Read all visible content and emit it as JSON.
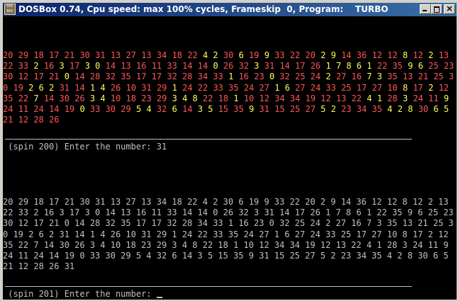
{
  "window": {
    "title": "DOSBox 0.74, Cpu speed: max 100% cycles, Frameskip  0, Program:    TURBO",
    "icon_label": "DOS BOX",
    "buttons": [
      "minimize-icon",
      "maximize-icon",
      "close-icon"
    ]
  },
  "colors": {
    "background": "#000000",
    "text": "#c0c0c0",
    "bright_high": "#ffff55",
    "bright_low": "#ff5555"
  },
  "spin200": {
    "sequence": "20 29 18 17 21 30 31 13 27 13 34 18 22 4 2 30 6 19 9 33 22 20 2 9 14 36 12 12 8 12 2 13 22 33 2 16 3 17 3 0 14 13 16 11 33 14 14 0 26 32 3 31 14 17 26 1 7 8 6 1 22 35 9 6 25 23 30 12 17 21 0 14 28 32 35 17 17 32 28 34 33 1 16 23 0 32 25 24 2 27 16 7 3 35 13 21 25 30 19 2 6 2 31 14 1 4 26 10 31 29 1 24 22 33 35 24 27 1 6 27 24 33 25 17 27 10 8 17 2 12 35 22 7 14 30 26 3 4 10 18 23 29 3 4 8 22 18 1 10 12 34 34 19 12 13 22 4 1 28 3 24 11 9 24 11 24 14 19 0 33 30 29 5 4 32 6 14 3 5 15 35 9 31 15 25 27 5 2 23 34 35 4 2 8 30 6 5 21 12 28 26",
    "prompt": " (spin 200) Enter the number: 31"
  },
  "spin201": {
    "sequence": "20 29 18 17 21 30 31 13 27 13 34 18 22 4 2 30 6 19 9 33 22 20 2 9 14 36 12 12 8 12 2 13 22 33 2 16 3 17 3 0 14 13 16 11 33 14 14 0 26 32 3 31 14 17 26 1 7 8 6 1 22 35 9 6 25 23 30 12 17 21 0 14 28 32 35 17 17 32 28 34 33 1 16 23 0 32 25 24 2 27 16 7 3 35 13 21 25 30 19 2 6 2 31 14 1 4 26 10 31 29 1 24 22 33 35 24 27 1 6 27 24 33 25 17 27 10 8 17 2 12 35 22 7 14 30 26 3 4 10 18 23 29 3 4 8 22 18 1 10 12 34 34 19 12 13 22 4 1 28 3 24 11 9 24 11 24 14 19 0 33 30 29 5 4 32 6 14 3 5 15 35 9 31 15 25 27 5 2 23 34 35 4 2 8 30 6 5 21 12 28 26 31",
    "prompt": " (spin 201) Enter the number: "
  }
}
